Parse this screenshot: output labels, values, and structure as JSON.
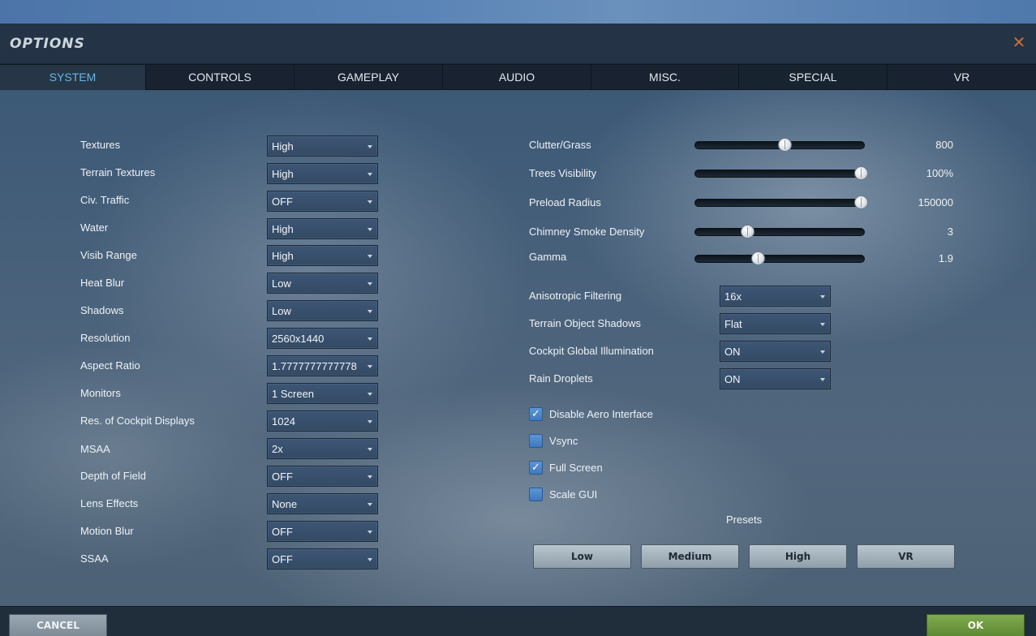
{
  "window": {
    "title": "OPTIONS",
    "close_icon": "close-icon",
    "accent": "#67b6e6",
    "close_color": "#c8703a"
  },
  "tabs": [
    {
      "label": "SYSTEM",
      "active": true
    },
    {
      "label": "CONTROLS",
      "active": false
    },
    {
      "label": "GAMEPLAY",
      "active": false
    },
    {
      "label": "AUDIO",
      "active": false
    },
    {
      "label": "MISC.",
      "active": false
    },
    {
      "label": "SPECIAL",
      "active": false
    },
    {
      "label": "VR",
      "active": false
    }
  ],
  "left_settings": [
    {
      "label": "Textures",
      "value": "High"
    },
    {
      "label": "Terrain Textures",
      "value": "High"
    },
    {
      "label": "Civ. Traffic",
      "value": "OFF"
    },
    {
      "label": "Water",
      "value": "High"
    },
    {
      "label": "Visib Range",
      "value": "High"
    },
    {
      "label": "Heat Blur",
      "value": "Low"
    },
    {
      "label": "Shadows",
      "value": "Low"
    },
    {
      "label": "Resolution",
      "value": "2560x1440"
    },
    {
      "label": "Aspect Ratio",
      "value": "1.7777777777778"
    },
    {
      "label": "Monitors",
      "value": "1 Screen"
    },
    {
      "label": "Res. of Cockpit Displays",
      "value": "1024"
    },
    {
      "label": "MSAA",
      "value": "2x"
    },
    {
      "label": "Depth of Field",
      "value": "OFF"
    },
    {
      "label": "Lens Effects",
      "value": "None"
    },
    {
      "label": "Motion Blur",
      "value": "OFF"
    },
    {
      "label": "SSAA",
      "value": "OFF"
    }
  ],
  "sliders": [
    {
      "label": "Clutter/Grass",
      "value": "800",
      "fraction": 0.53
    },
    {
      "label": "Trees Visibility",
      "value": "100%",
      "fraction": 0.98
    },
    {
      "label": "Preload Radius",
      "value": "150000",
      "fraction": 0.98
    },
    {
      "label": "Chimney Smoke Density",
      "value": "3",
      "fraction": 0.31
    },
    {
      "label": "Gamma",
      "value": "1.9",
      "fraction": 0.37
    }
  ],
  "right_settings": [
    {
      "label": "Anisotropic Filtering",
      "value": "16x"
    },
    {
      "label": "Terrain Object Shadows",
      "value": "Flat"
    },
    {
      "label": "Cockpit Global Illumination",
      "value": "ON"
    },
    {
      "label": "Rain Droplets",
      "value": "ON"
    }
  ],
  "checkboxes": [
    {
      "label": "Disable Aero Interface",
      "checked": true
    },
    {
      "label": "Vsync",
      "checked": false
    },
    {
      "label": "Full Screen",
      "checked": true
    },
    {
      "label": "Scale GUI",
      "checked": false
    }
  ],
  "presets": {
    "label": "Presets",
    "buttons": [
      "Low",
      "Medium",
      "High",
      "VR"
    ]
  },
  "footer": {
    "cancel_label": "CANCEL",
    "ok_label": "OK",
    "ok_color": "#6f9a42"
  }
}
